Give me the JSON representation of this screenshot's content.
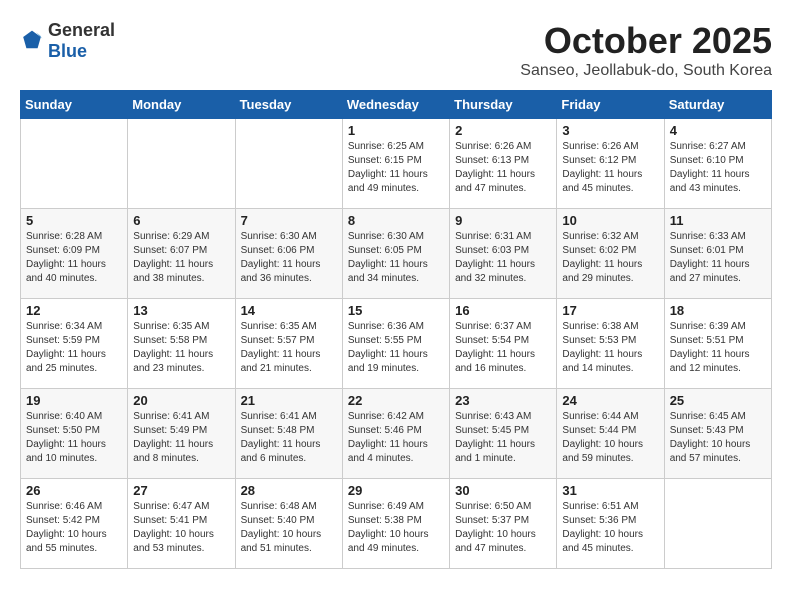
{
  "header": {
    "logo_general": "General",
    "logo_blue": "Blue",
    "month": "October 2025",
    "location": "Sanseo, Jeollabuk-do, South Korea"
  },
  "days_of_week": [
    "Sunday",
    "Monday",
    "Tuesday",
    "Wednesday",
    "Thursday",
    "Friday",
    "Saturday"
  ],
  "weeks": [
    [
      {
        "day": "",
        "info": ""
      },
      {
        "day": "",
        "info": ""
      },
      {
        "day": "",
        "info": ""
      },
      {
        "day": "1",
        "info": "Sunrise: 6:25 AM\nSunset: 6:15 PM\nDaylight: 11 hours and 49 minutes."
      },
      {
        "day": "2",
        "info": "Sunrise: 6:26 AM\nSunset: 6:13 PM\nDaylight: 11 hours and 47 minutes."
      },
      {
        "day": "3",
        "info": "Sunrise: 6:26 AM\nSunset: 6:12 PM\nDaylight: 11 hours and 45 minutes."
      },
      {
        "day": "4",
        "info": "Sunrise: 6:27 AM\nSunset: 6:10 PM\nDaylight: 11 hours and 43 minutes."
      }
    ],
    [
      {
        "day": "5",
        "info": "Sunrise: 6:28 AM\nSunset: 6:09 PM\nDaylight: 11 hours and 40 minutes."
      },
      {
        "day": "6",
        "info": "Sunrise: 6:29 AM\nSunset: 6:07 PM\nDaylight: 11 hours and 38 minutes."
      },
      {
        "day": "7",
        "info": "Sunrise: 6:30 AM\nSunset: 6:06 PM\nDaylight: 11 hours and 36 minutes."
      },
      {
        "day": "8",
        "info": "Sunrise: 6:30 AM\nSunset: 6:05 PM\nDaylight: 11 hours and 34 minutes."
      },
      {
        "day": "9",
        "info": "Sunrise: 6:31 AM\nSunset: 6:03 PM\nDaylight: 11 hours and 32 minutes."
      },
      {
        "day": "10",
        "info": "Sunrise: 6:32 AM\nSunset: 6:02 PM\nDaylight: 11 hours and 29 minutes."
      },
      {
        "day": "11",
        "info": "Sunrise: 6:33 AM\nSunset: 6:01 PM\nDaylight: 11 hours and 27 minutes."
      }
    ],
    [
      {
        "day": "12",
        "info": "Sunrise: 6:34 AM\nSunset: 5:59 PM\nDaylight: 11 hours and 25 minutes."
      },
      {
        "day": "13",
        "info": "Sunrise: 6:35 AM\nSunset: 5:58 PM\nDaylight: 11 hours and 23 minutes."
      },
      {
        "day": "14",
        "info": "Sunrise: 6:35 AM\nSunset: 5:57 PM\nDaylight: 11 hours and 21 minutes."
      },
      {
        "day": "15",
        "info": "Sunrise: 6:36 AM\nSunset: 5:55 PM\nDaylight: 11 hours and 19 minutes."
      },
      {
        "day": "16",
        "info": "Sunrise: 6:37 AM\nSunset: 5:54 PM\nDaylight: 11 hours and 16 minutes."
      },
      {
        "day": "17",
        "info": "Sunrise: 6:38 AM\nSunset: 5:53 PM\nDaylight: 11 hours and 14 minutes."
      },
      {
        "day": "18",
        "info": "Sunrise: 6:39 AM\nSunset: 5:51 PM\nDaylight: 11 hours and 12 minutes."
      }
    ],
    [
      {
        "day": "19",
        "info": "Sunrise: 6:40 AM\nSunset: 5:50 PM\nDaylight: 11 hours and 10 minutes."
      },
      {
        "day": "20",
        "info": "Sunrise: 6:41 AM\nSunset: 5:49 PM\nDaylight: 11 hours and 8 minutes."
      },
      {
        "day": "21",
        "info": "Sunrise: 6:41 AM\nSunset: 5:48 PM\nDaylight: 11 hours and 6 minutes."
      },
      {
        "day": "22",
        "info": "Sunrise: 6:42 AM\nSunset: 5:46 PM\nDaylight: 11 hours and 4 minutes."
      },
      {
        "day": "23",
        "info": "Sunrise: 6:43 AM\nSunset: 5:45 PM\nDaylight: 11 hours and 1 minute."
      },
      {
        "day": "24",
        "info": "Sunrise: 6:44 AM\nSunset: 5:44 PM\nDaylight: 10 hours and 59 minutes."
      },
      {
        "day": "25",
        "info": "Sunrise: 6:45 AM\nSunset: 5:43 PM\nDaylight: 10 hours and 57 minutes."
      }
    ],
    [
      {
        "day": "26",
        "info": "Sunrise: 6:46 AM\nSunset: 5:42 PM\nDaylight: 10 hours and 55 minutes."
      },
      {
        "day": "27",
        "info": "Sunrise: 6:47 AM\nSunset: 5:41 PM\nDaylight: 10 hours and 53 minutes."
      },
      {
        "day": "28",
        "info": "Sunrise: 6:48 AM\nSunset: 5:40 PM\nDaylight: 10 hours and 51 minutes."
      },
      {
        "day": "29",
        "info": "Sunrise: 6:49 AM\nSunset: 5:38 PM\nDaylight: 10 hours and 49 minutes."
      },
      {
        "day": "30",
        "info": "Sunrise: 6:50 AM\nSunset: 5:37 PM\nDaylight: 10 hours and 47 minutes."
      },
      {
        "day": "31",
        "info": "Sunrise: 6:51 AM\nSunset: 5:36 PM\nDaylight: 10 hours and 45 minutes."
      },
      {
        "day": "",
        "info": ""
      }
    ]
  ]
}
